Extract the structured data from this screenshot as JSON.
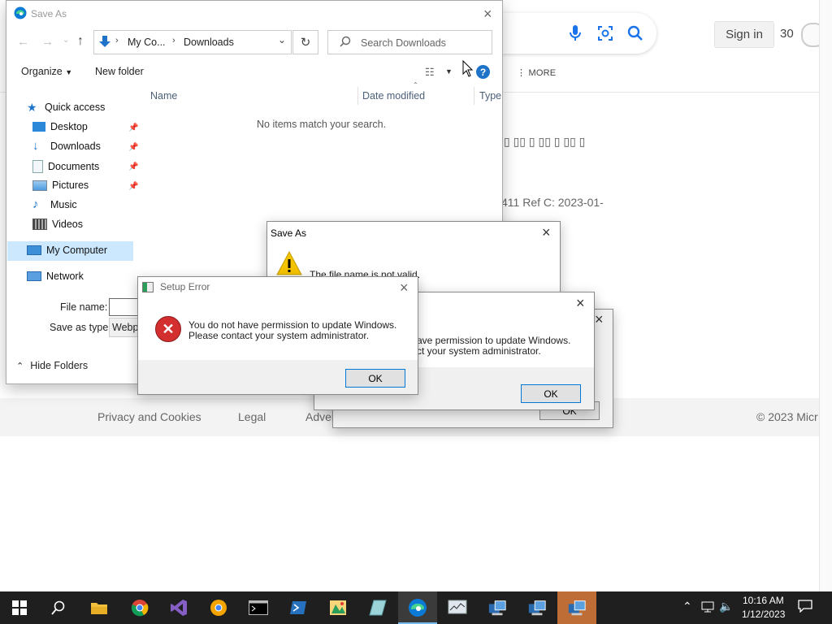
{
  "browser": {
    "signin_label": "Sign in",
    "points": "30",
    "more_label": "MORE",
    "korean_text": "▯ ▯▯ ▯ ▯▯ ▯ ▯▯ ▯",
    "ref_text": "411 Ref C: 2023-01-",
    "footer": {
      "privacy": "Privacy and Cookies",
      "legal": "Legal",
      "advertise": "Adver",
      "copyright": "© 2023 Micr"
    }
  },
  "save_as_main": {
    "title": "Save As",
    "breadcrumb": [
      "My Co...",
      "Downloads"
    ],
    "search_placeholder": "Search Downloads",
    "organize_label": "Organize",
    "new_folder_label": "New folder",
    "columns": [
      "Name",
      "Date modified",
      "Type"
    ],
    "empty_message": "No items match your search.",
    "nav": {
      "quick_access": "Quick access",
      "items": [
        "Desktop",
        "Downloads",
        "Documents",
        "Pictures",
        "Music",
        "Videos"
      ],
      "my_computer": "My Computer",
      "network": "Network"
    },
    "file_name_label": "File name:",
    "file_name_value": "",
    "save_type_label": "Save as type:",
    "save_type_value": "Webpa",
    "hide_folders_label": "Hide Folders"
  },
  "save_as_error": {
    "title": "Save As",
    "message": "The file name is not valid."
  },
  "setup_error_back": {
    "message_line1": "ave permission to update Windows.",
    "message_line2": "ct your system administrator.",
    "ok_label": "OK"
  },
  "setup_error_far": {
    "ok_label": "OK"
  },
  "setup_error_front": {
    "title": "Setup Error",
    "message_line1": "You do not have permission to update Windows.",
    "message_line2": "Please contact your system administrator.",
    "ok_label": "OK"
  },
  "taskbar": {
    "time": "10:16 AM",
    "date": "1/12/2023"
  },
  "colors": {
    "accent": "#0078d7",
    "error_red": "#d32f2f",
    "taskbar_bg": "#1f1f1f",
    "warning_yellow": "#f5c400"
  }
}
